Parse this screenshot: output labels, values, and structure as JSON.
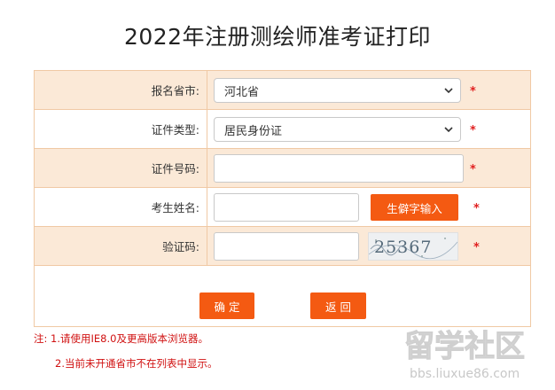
{
  "page": {
    "title": "2022年注册测绘师准考证打印"
  },
  "form": {
    "province": {
      "label": "报名省市:",
      "selected": "河北省"
    },
    "id_type": {
      "label": "证件类型:",
      "selected": "居民身份证"
    },
    "id_number": {
      "label": "证件号码:",
      "value": ""
    },
    "name": {
      "label": "考生姓名:",
      "value": "",
      "rare_char_button": "生僻字输入"
    },
    "captcha": {
      "label": "验证码:",
      "value": "",
      "image_text": "25367"
    },
    "required_mark": "*",
    "confirm_label": "确 定",
    "back_label": "返 回"
  },
  "notes": {
    "line1": "注: 1.请使用IE8.0及更高版本浏览器。",
    "line2": "2.当前未开通省市不在列表中显示。"
  },
  "watermark": {
    "brand": "留学社区",
    "url": "bbs.liuxue86.com"
  },
  "colors": {
    "accent": "#f45a12",
    "row_shade": "#fbe9d7",
    "border": "#f0c9a4",
    "required": "#e02020",
    "note_text": "#d01010"
  }
}
